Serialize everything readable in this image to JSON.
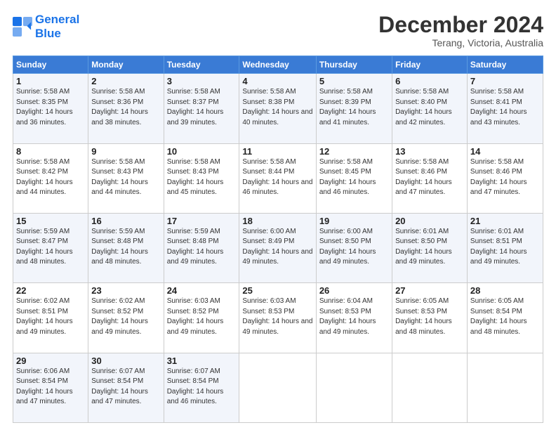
{
  "logo": {
    "line1": "General",
    "line2": "Blue"
  },
  "title": "December 2024",
  "subtitle": "Terang, Victoria, Australia",
  "days_header": [
    "Sunday",
    "Monday",
    "Tuesday",
    "Wednesday",
    "Thursday",
    "Friday",
    "Saturday"
  ],
  "weeks": [
    [
      {
        "day": "1",
        "sunrise": "Sunrise: 5:58 AM",
        "sunset": "Sunset: 8:35 PM",
        "daylight": "Daylight: 14 hours and 36 minutes."
      },
      {
        "day": "2",
        "sunrise": "Sunrise: 5:58 AM",
        "sunset": "Sunset: 8:36 PM",
        "daylight": "Daylight: 14 hours and 38 minutes."
      },
      {
        "day": "3",
        "sunrise": "Sunrise: 5:58 AM",
        "sunset": "Sunset: 8:37 PM",
        "daylight": "Daylight: 14 hours and 39 minutes."
      },
      {
        "day": "4",
        "sunrise": "Sunrise: 5:58 AM",
        "sunset": "Sunset: 8:38 PM",
        "daylight": "Daylight: 14 hours and 40 minutes."
      },
      {
        "day": "5",
        "sunrise": "Sunrise: 5:58 AM",
        "sunset": "Sunset: 8:39 PM",
        "daylight": "Daylight: 14 hours and 41 minutes."
      },
      {
        "day": "6",
        "sunrise": "Sunrise: 5:58 AM",
        "sunset": "Sunset: 8:40 PM",
        "daylight": "Daylight: 14 hours and 42 minutes."
      },
      {
        "day": "7",
        "sunrise": "Sunrise: 5:58 AM",
        "sunset": "Sunset: 8:41 PM",
        "daylight": "Daylight: 14 hours and 43 minutes."
      }
    ],
    [
      {
        "day": "8",
        "sunrise": "Sunrise: 5:58 AM",
        "sunset": "Sunset: 8:42 PM",
        "daylight": "Daylight: 14 hours and 44 minutes."
      },
      {
        "day": "9",
        "sunrise": "Sunrise: 5:58 AM",
        "sunset": "Sunset: 8:43 PM",
        "daylight": "Daylight: 14 hours and 44 minutes."
      },
      {
        "day": "10",
        "sunrise": "Sunrise: 5:58 AM",
        "sunset": "Sunset: 8:43 PM",
        "daylight": "Daylight: 14 hours and 45 minutes."
      },
      {
        "day": "11",
        "sunrise": "Sunrise: 5:58 AM",
        "sunset": "Sunset: 8:44 PM",
        "daylight": "Daylight: 14 hours and 46 minutes."
      },
      {
        "day": "12",
        "sunrise": "Sunrise: 5:58 AM",
        "sunset": "Sunset: 8:45 PM",
        "daylight": "Daylight: 14 hours and 46 minutes."
      },
      {
        "day": "13",
        "sunrise": "Sunrise: 5:58 AM",
        "sunset": "Sunset: 8:46 PM",
        "daylight": "Daylight: 14 hours and 47 minutes."
      },
      {
        "day": "14",
        "sunrise": "Sunrise: 5:58 AM",
        "sunset": "Sunset: 8:46 PM",
        "daylight": "Daylight: 14 hours and 47 minutes."
      }
    ],
    [
      {
        "day": "15",
        "sunrise": "Sunrise: 5:59 AM",
        "sunset": "Sunset: 8:47 PM",
        "daylight": "Daylight: 14 hours and 48 minutes."
      },
      {
        "day": "16",
        "sunrise": "Sunrise: 5:59 AM",
        "sunset": "Sunset: 8:48 PM",
        "daylight": "Daylight: 14 hours and 48 minutes."
      },
      {
        "day": "17",
        "sunrise": "Sunrise: 5:59 AM",
        "sunset": "Sunset: 8:48 PM",
        "daylight": "Daylight: 14 hours and 49 minutes."
      },
      {
        "day": "18",
        "sunrise": "Sunrise: 6:00 AM",
        "sunset": "Sunset: 8:49 PM",
        "daylight": "Daylight: 14 hours and 49 minutes."
      },
      {
        "day": "19",
        "sunrise": "Sunrise: 6:00 AM",
        "sunset": "Sunset: 8:50 PM",
        "daylight": "Daylight: 14 hours and 49 minutes."
      },
      {
        "day": "20",
        "sunrise": "Sunrise: 6:01 AM",
        "sunset": "Sunset: 8:50 PM",
        "daylight": "Daylight: 14 hours and 49 minutes."
      },
      {
        "day": "21",
        "sunrise": "Sunrise: 6:01 AM",
        "sunset": "Sunset: 8:51 PM",
        "daylight": "Daylight: 14 hours and 49 minutes."
      }
    ],
    [
      {
        "day": "22",
        "sunrise": "Sunrise: 6:02 AM",
        "sunset": "Sunset: 8:51 PM",
        "daylight": "Daylight: 14 hours and 49 minutes."
      },
      {
        "day": "23",
        "sunrise": "Sunrise: 6:02 AM",
        "sunset": "Sunset: 8:52 PM",
        "daylight": "Daylight: 14 hours and 49 minutes."
      },
      {
        "day": "24",
        "sunrise": "Sunrise: 6:03 AM",
        "sunset": "Sunset: 8:52 PM",
        "daylight": "Daylight: 14 hours and 49 minutes."
      },
      {
        "day": "25",
        "sunrise": "Sunrise: 6:03 AM",
        "sunset": "Sunset: 8:53 PM",
        "daylight": "Daylight: 14 hours and 49 minutes."
      },
      {
        "day": "26",
        "sunrise": "Sunrise: 6:04 AM",
        "sunset": "Sunset: 8:53 PM",
        "daylight": "Daylight: 14 hours and 49 minutes."
      },
      {
        "day": "27",
        "sunrise": "Sunrise: 6:05 AM",
        "sunset": "Sunset: 8:53 PM",
        "daylight": "Daylight: 14 hours and 48 minutes."
      },
      {
        "day": "28",
        "sunrise": "Sunrise: 6:05 AM",
        "sunset": "Sunset: 8:54 PM",
        "daylight": "Daylight: 14 hours and 48 minutes."
      }
    ],
    [
      {
        "day": "29",
        "sunrise": "Sunrise: 6:06 AM",
        "sunset": "Sunset: 8:54 PM",
        "daylight": "Daylight: 14 hours and 47 minutes."
      },
      {
        "day": "30",
        "sunrise": "Sunrise: 6:07 AM",
        "sunset": "Sunset: 8:54 PM",
        "daylight": "Daylight: 14 hours and 47 minutes."
      },
      {
        "day": "31",
        "sunrise": "Sunrise: 6:07 AM",
        "sunset": "Sunset: 8:54 PM",
        "daylight": "Daylight: 14 hours and 46 minutes."
      },
      null,
      null,
      null,
      null
    ]
  ]
}
